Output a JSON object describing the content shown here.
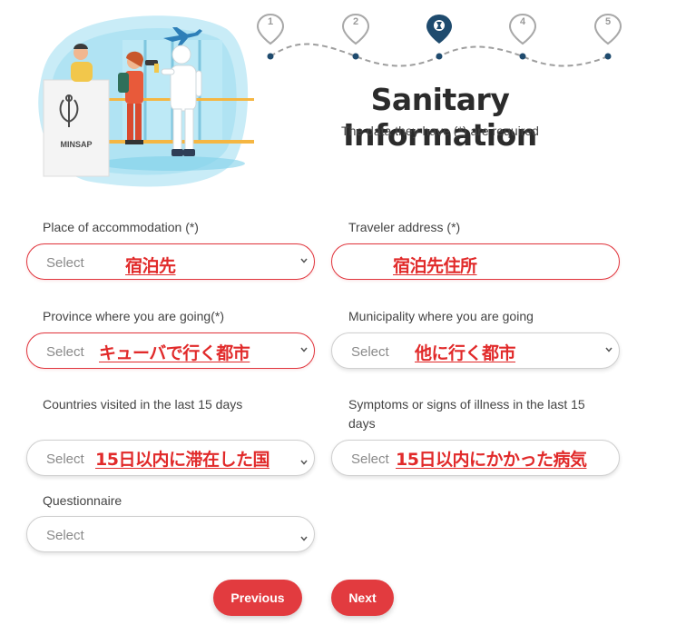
{
  "header": {
    "title": "Sanitary Information",
    "subtitle": "The data they have (*) are required",
    "illustration_sign": "MINSAP"
  },
  "stepper": {
    "steps": [
      {
        "label": "1",
        "state": "pending"
      },
      {
        "label": "2",
        "state": "pending"
      },
      {
        "label": "",
        "state": "active",
        "icon": "sanitary-icon"
      },
      {
        "label": "4",
        "state": "pending"
      },
      {
        "label": "5",
        "state": "pending"
      }
    ]
  },
  "form": {
    "accommodation": {
      "label": "Place of accommodation (*)",
      "placeholder": "Select",
      "annotation": "宿泊先"
    },
    "traveler_address": {
      "label": "Traveler address (*)",
      "annotation": "宿泊先住所"
    },
    "province": {
      "label": "Province where you are going(*)",
      "placeholder": "Select",
      "annotation": "キューバで行く都市"
    },
    "municipality": {
      "label": "Municipality where you are going",
      "placeholder": "Select",
      "annotation": "他に行く都市"
    },
    "countries": {
      "label": "Countries visited in the last 15 days",
      "placeholder": "Select",
      "annotation": "15日以内に滞在した国"
    },
    "symptoms": {
      "label_line1": "Symptoms or signs of illness in the last 15",
      "label_line2": "days",
      "placeholder": "Select",
      "annotation": "15日以内にかかった病気"
    },
    "questionnaire": {
      "label": "Questionnaire",
      "placeholder": "Select"
    }
  },
  "buttons": {
    "previous": "Previous",
    "next": "Next"
  },
  "colors": {
    "accent": "#e23b3f",
    "annotation": "#e12a2a",
    "error_border": "#e0343c",
    "step_active": "#1f4b6e"
  }
}
